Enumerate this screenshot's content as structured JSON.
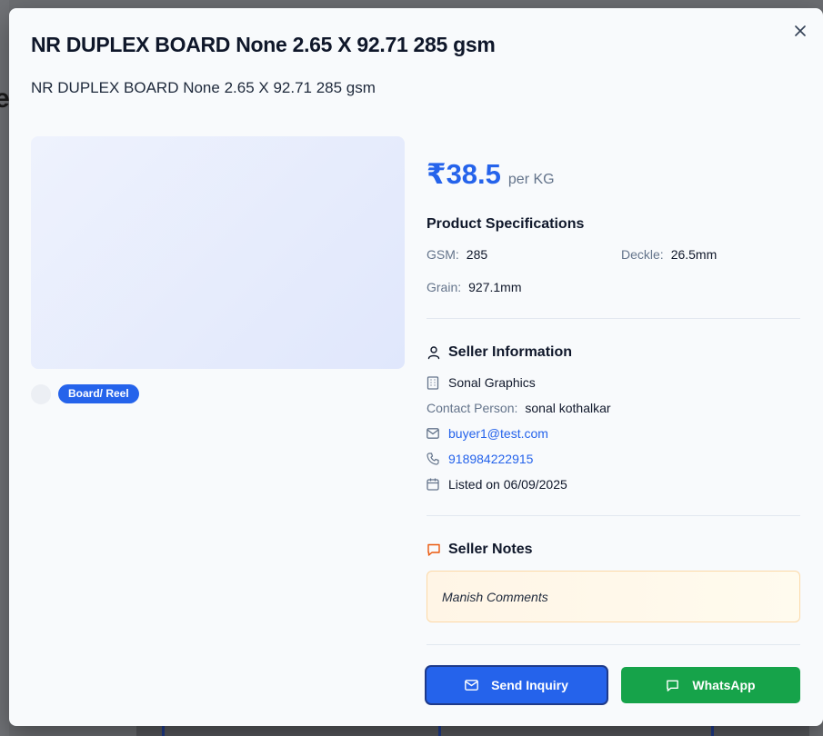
{
  "modal": {
    "title": "NR DUPLEX BOARD None 2.65 X 92.71 285 gsm",
    "subtitle": "NR DUPLEX BOARD None 2.65 X 92.71 285 gsm",
    "category_badge": "Board/ Reel"
  },
  "price": {
    "amount": "₹38.5",
    "unit": "per KG"
  },
  "specs": {
    "title": "Product Specifications",
    "gsm_label": "GSM:",
    "gsm_value": "285",
    "deckle_label": "Deckle:",
    "deckle_value": "26.5mm",
    "grain_label": "Grain:",
    "grain_value": "927.1mm"
  },
  "seller": {
    "title": "Seller Information",
    "company": "Sonal Graphics",
    "contact_label": "Contact Person:",
    "contact_value": "sonal kothalkar",
    "email": "buyer1@test.com",
    "phone": "918984222915",
    "listed": "Listed on 06/09/2025"
  },
  "notes": {
    "title": "Seller Notes",
    "text": "Manish Comments"
  },
  "actions": {
    "inquiry_label": "Send Inquiry",
    "whatsapp_label": "WhatsApp"
  },
  "colors": {
    "accent": "#2563eb",
    "whatsapp": "#16a34a",
    "notes_icon": "#ea580c"
  },
  "icons": [
    "close-icon",
    "user-icon",
    "building-icon",
    "mail-icon",
    "phone-icon",
    "calendar-icon",
    "message-square-icon"
  ]
}
